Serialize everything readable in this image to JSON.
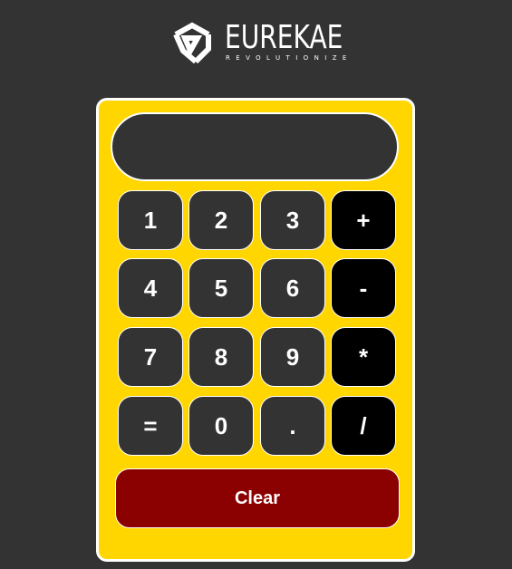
{
  "brand": {
    "name": "EUREKAE",
    "tagline": "REVOLUTIONIZE",
    "icon": "triangle-logo-icon"
  },
  "calculator": {
    "display_value": "",
    "keys": [
      [
        "1",
        "2",
        "3",
        "+"
      ],
      [
        "4",
        "5",
        "6",
        "-"
      ],
      [
        "7",
        "8",
        "9",
        "*"
      ],
      [
        "=",
        "0",
        ".",
        "/"
      ]
    ],
    "clear_label": "Clear"
  },
  "colors": {
    "page_background": "#333333",
    "calculator_body": "#ffd600",
    "digit_key": "#333333",
    "operator_key": "#000000",
    "clear_key": "#8b0000",
    "text": "#ffffff"
  }
}
